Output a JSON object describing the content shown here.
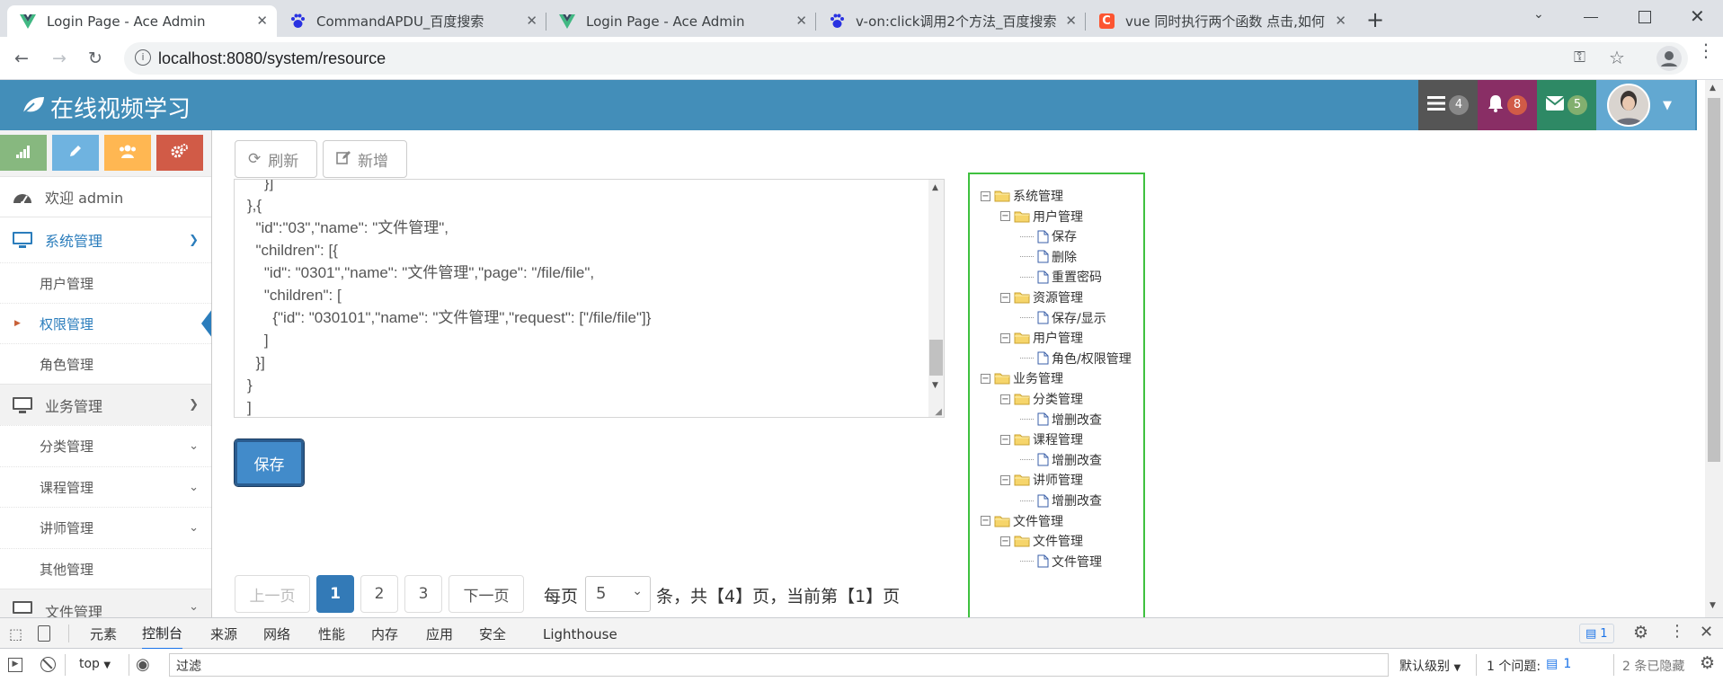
{
  "browser": {
    "tabs": [
      {
        "title": "Login Page - Ace Admin",
        "favicon": "vue-icon",
        "active": true
      },
      {
        "title": "CommandAPDU_百度搜索",
        "favicon": "baidu-icon",
        "active": false
      },
      {
        "title": "Login Page - Ace Admin",
        "favicon": "vue-icon",
        "active": false
      },
      {
        "title": "v-on:click调用2个方法_百度搜索",
        "favicon": "baidu-icon",
        "active": false
      },
      {
        "title": "vue 同时执行两个函数 点击,如何",
        "favicon": "csdn-icon",
        "active": false
      }
    ],
    "url": "localhost:8080/system/resource"
  },
  "navbar": {
    "brand": "在线视频学习",
    "tasks_count": "4",
    "notifications_count": "8",
    "messages_count": "5",
    "colors": {
      "bar": "#438eb9",
      "tasks": "#555555",
      "notifications": "#892e65",
      "messages": "#2e8965",
      "user": "#62a8d1"
    }
  },
  "sidebar": {
    "shortcuts": [
      {
        "icon": "signal-icon",
        "color": "#87b87f"
      },
      {
        "icon": "pencil-icon",
        "color": "#6fb3e0"
      },
      {
        "icon": "users-icon",
        "color": "#ffb752"
      },
      {
        "icon": "cogs-icon",
        "color": "#d15b47"
      }
    ],
    "welcome": "欢迎 admin",
    "system": {
      "label": "系统管理",
      "items": [
        "用户管理",
        "权限管理",
        "角色管理"
      ]
    },
    "business": {
      "label": "业务管理",
      "items": [
        "分类管理",
        "课程管理",
        "讲师管理",
        "其他管理"
      ]
    },
    "files_label": "文件管理"
  },
  "main": {
    "refresh_label": "刷新",
    "add_label": "新增",
    "textarea_text": "    }]\n},{\n  \"id\":\"03\",\"name\": \"文件管理\",\n  \"children\": [{\n    \"id\": \"0301\",\"name\": \"文件管理\",\"page\": \"/file/file\",\n    \"children\": [\n      {\"id\": \"030101\",\"name\": \"文件管理\",\"request\": [\"/file/file\"]}\n    ]\n  }]\n}\n]",
    "save_label": "保存",
    "pagination": {
      "prev": "上一页",
      "pages": [
        "1",
        "2",
        "3"
      ],
      "current": "1",
      "next": "下一页",
      "per_page_label": "每页",
      "per_page_value": "5",
      "summary": "条，共【4】页，当前第【1】页"
    }
  },
  "tree": [
    {
      "label": "系统管理",
      "depth": 0,
      "type": "folder"
    },
    {
      "label": "用户管理",
      "depth": 1,
      "type": "folder"
    },
    {
      "label": "保存",
      "depth": 2,
      "type": "file"
    },
    {
      "label": "删除",
      "depth": 2,
      "type": "file"
    },
    {
      "label": "重置密码",
      "depth": 2,
      "type": "file"
    },
    {
      "label": "资源管理",
      "depth": 1,
      "type": "folder"
    },
    {
      "label": "保存/显示",
      "depth": 2,
      "type": "file"
    },
    {
      "label": "用户管理",
      "depth": 1,
      "type": "folder"
    },
    {
      "label": "角色/权限管理",
      "depth": 2,
      "type": "file"
    },
    {
      "label": "业务管理",
      "depth": 0,
      "type": "folder"
    },
    {
      "label": "分类管理",
      "depth": 1,
      "type": "folder"
    },
    {
      "label": "增删改查",
      "depth": 2,
      "type": "file"
    },
    {
      "label": "课程管理",
      "depth": 1,
      "type": "folder"
    },
    {
      "label": "增删改查",
      "depth": 2,
      "type": "file"
    },
    {
      "label": "讲师管理",
      "depth": 1,
      "type": "folder"
    },
    {
      "label": "增删改查",
      "depth": 2,
      "type": "file"
    },
    {
      "label": "文件管理",
      "depth": 0,
      "type": "folder"
    },
    {
      "label": "文件管理",
      "depth": 1,
      "type": "folder"
    },
    {
      "label": "文件管理",
      "depth": 2,
      "type": "file"
    }
  ],
  "devtools": {
    "tabs": [
      "元素",
      "控制台",
      "来源",
      "网络",
      "性能",
      "内存",
      "应用",
      "安全",
      "Lighthouse"
    ],
    "active_tab": "控制台",
    "issues_badge": "1",
    "context": "top",
    "filter_placeholder": "过滤",
    "level": "默认级别",
    "issues_label": "1 个问题:",
    "issues_count": "1",
    "hidden_label": "2 条已隐藏"
  }
}
